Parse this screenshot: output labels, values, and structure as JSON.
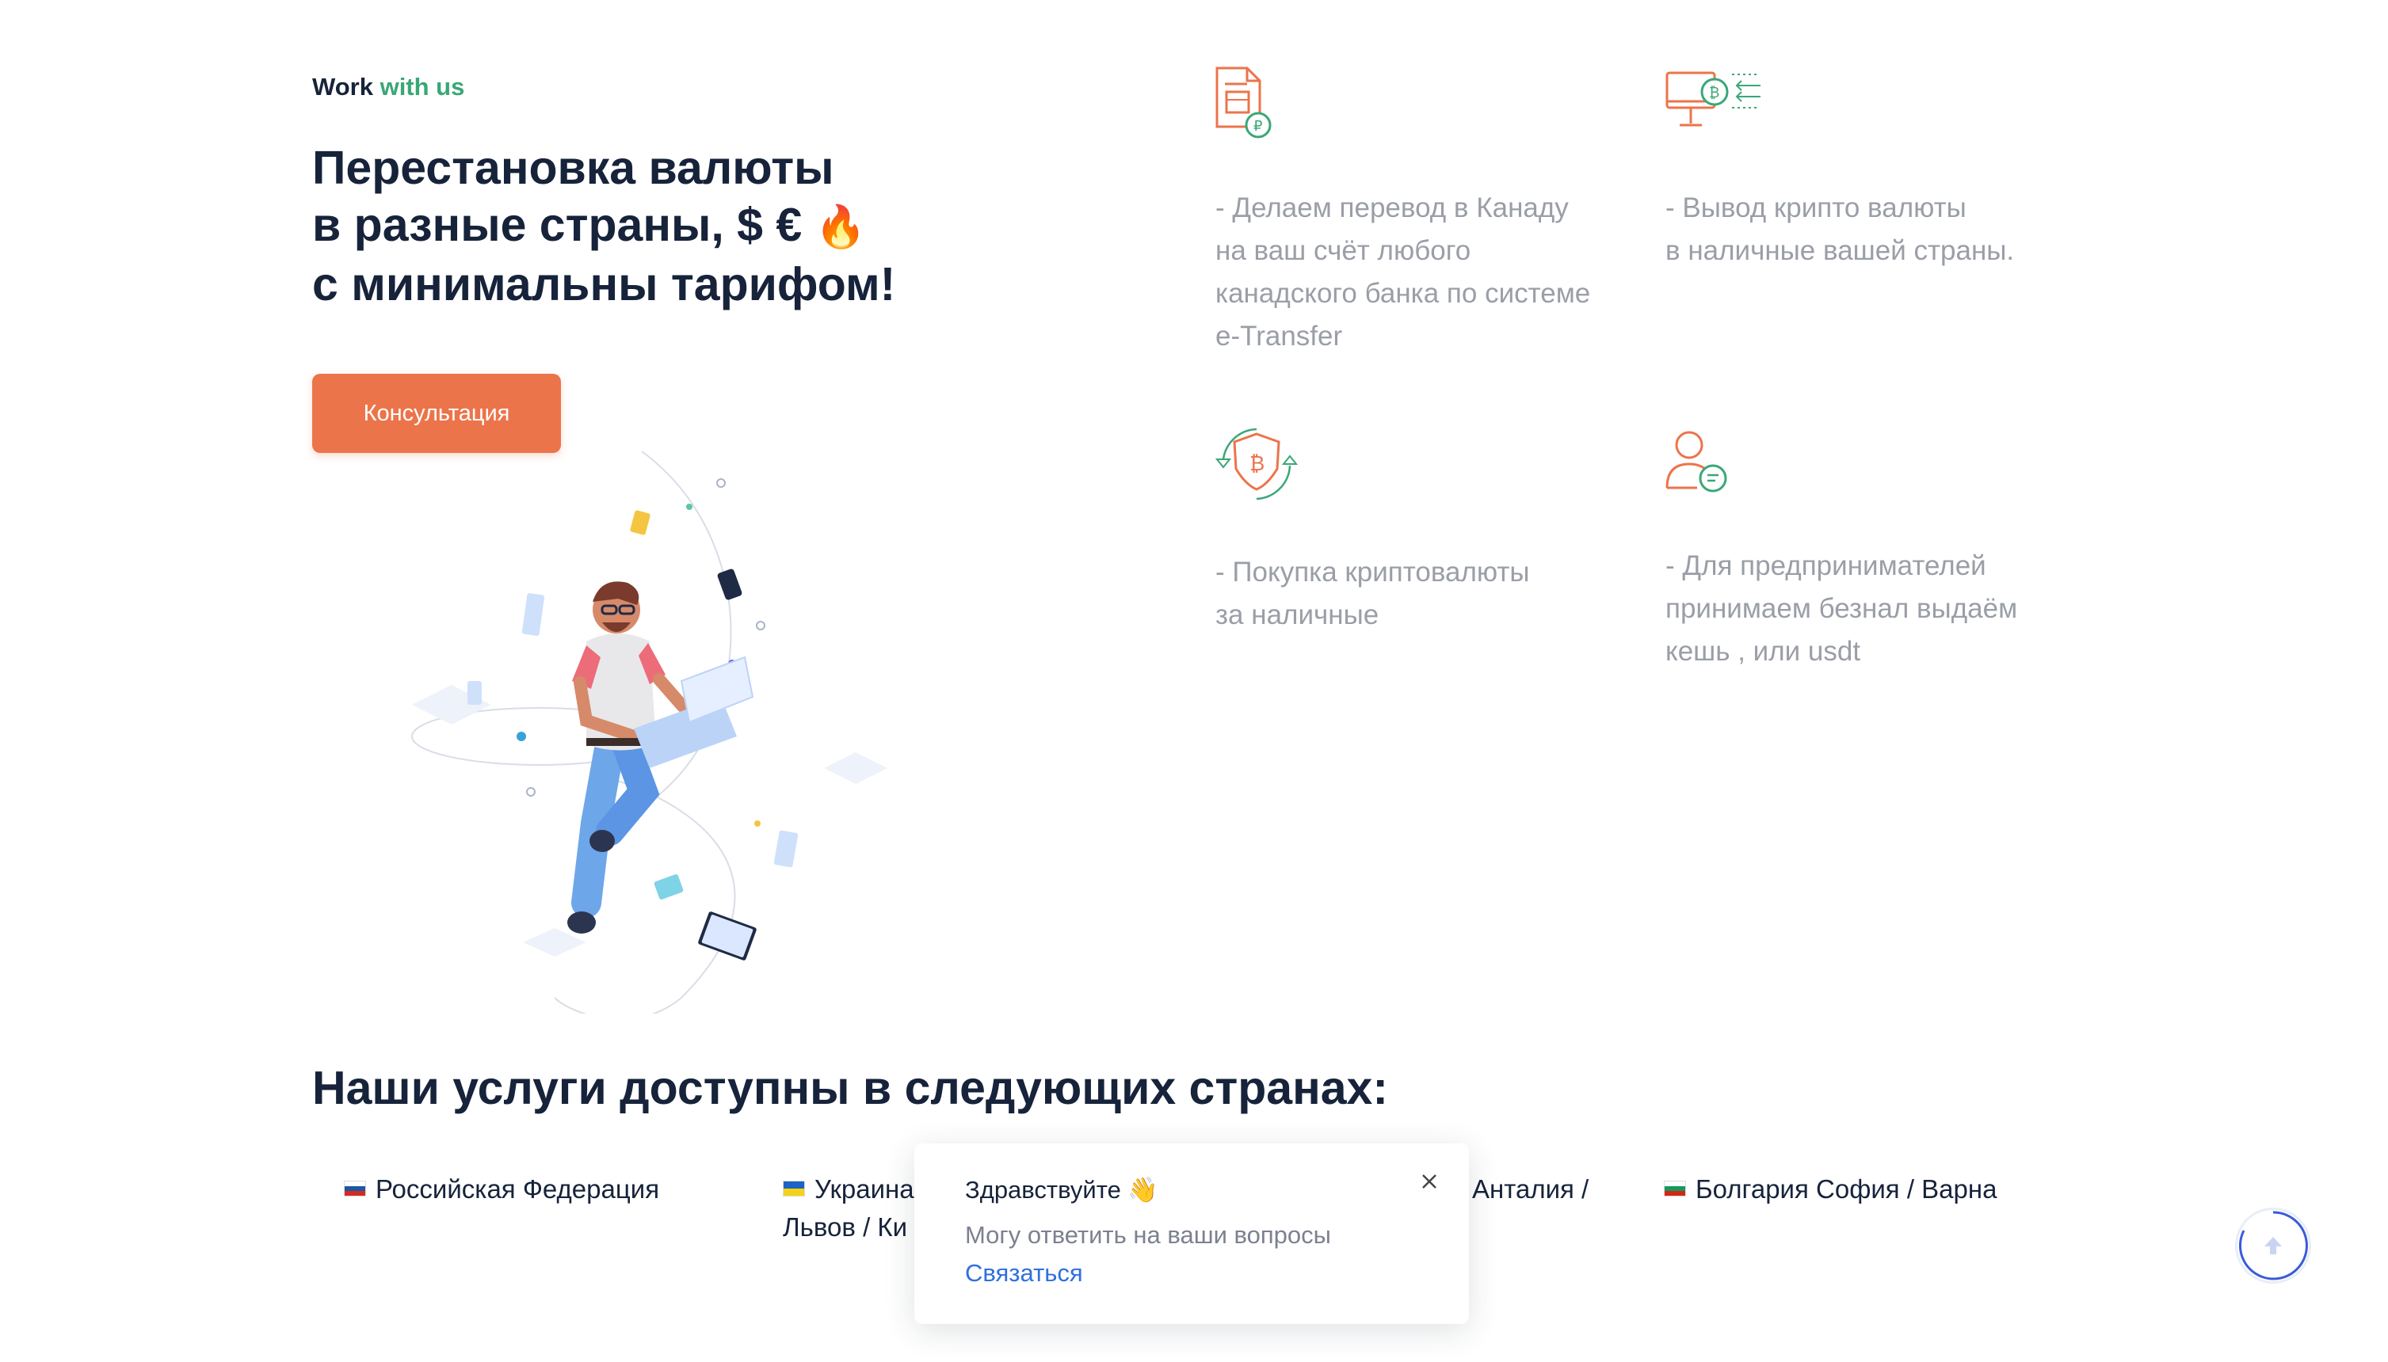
{
  "hero": {
    "eyebrow_lead": "Work",
    "eyebrow_accent": "with us",
    "title_lines": [
      "Перестановка валюты",
      "в разные страны, $ €",
      "с минимальны тарифом!"
    ],
    "title_emoji": "🔥",
    "cta_label": "Консультация"
  },
  "features": [
    {
      "icon": "document-coin-icon",
      "lines": [
        "- Делаем перевод в Канаду",
        "на ваш счёт любого",
        "канадского банка по системе",
        "e-Transfer"
      ]
    },
    {
      "icon": "monitor-bitcoin-icon",
      "lines": [
        "- Вывод крипто валюты",
        "в наличные вашей страны."
      ]
    },
    {
      "icon": "bitcoin-shield-exchange-icon",
      "lines": [
        "- Покупка криптовалюты",
        "за наличные"
      ]
    },
    {
      "icon": "user-chat-icon",
      "lines": [
        "- Для предпринимателей",
        "принимаем безнал выдаём",
        "кешь , или usdt"
      ]
    }
  ],
  "countries": {
    "title": "Наши услуги доступны в следующих странах:",
    "items": [
      {
        "flag": "ru",
        "text": "Российская Федерация"
      },
      {
        "flag": "ua",
        "line1": "Украина",
        "line2": "Львов / Ки"
      },
      {
        "text": "Анталия /"
      },
      {
        "flag": "bg",
        "text": "Болгария София / Варна"
      }
    ]
  },
  "chat": {
    "greeting": "Здравствуйте 👋",
    "message": "Могу ответить на ваши вопросы",
    "link": "Связаться",
    "close_icon": "close-icon"
  },
  "scroll_top": {
    "icon": "arrow-up-icon"
  },
  "colors": {
    "accent_orange": "#ec744a",
    "accent_green": "#3aa776",
    "text_dark": "#16233a",
    "text_muted": "#9a9ea6",
    "link_blue": "#2f6fe0"
  }
}
